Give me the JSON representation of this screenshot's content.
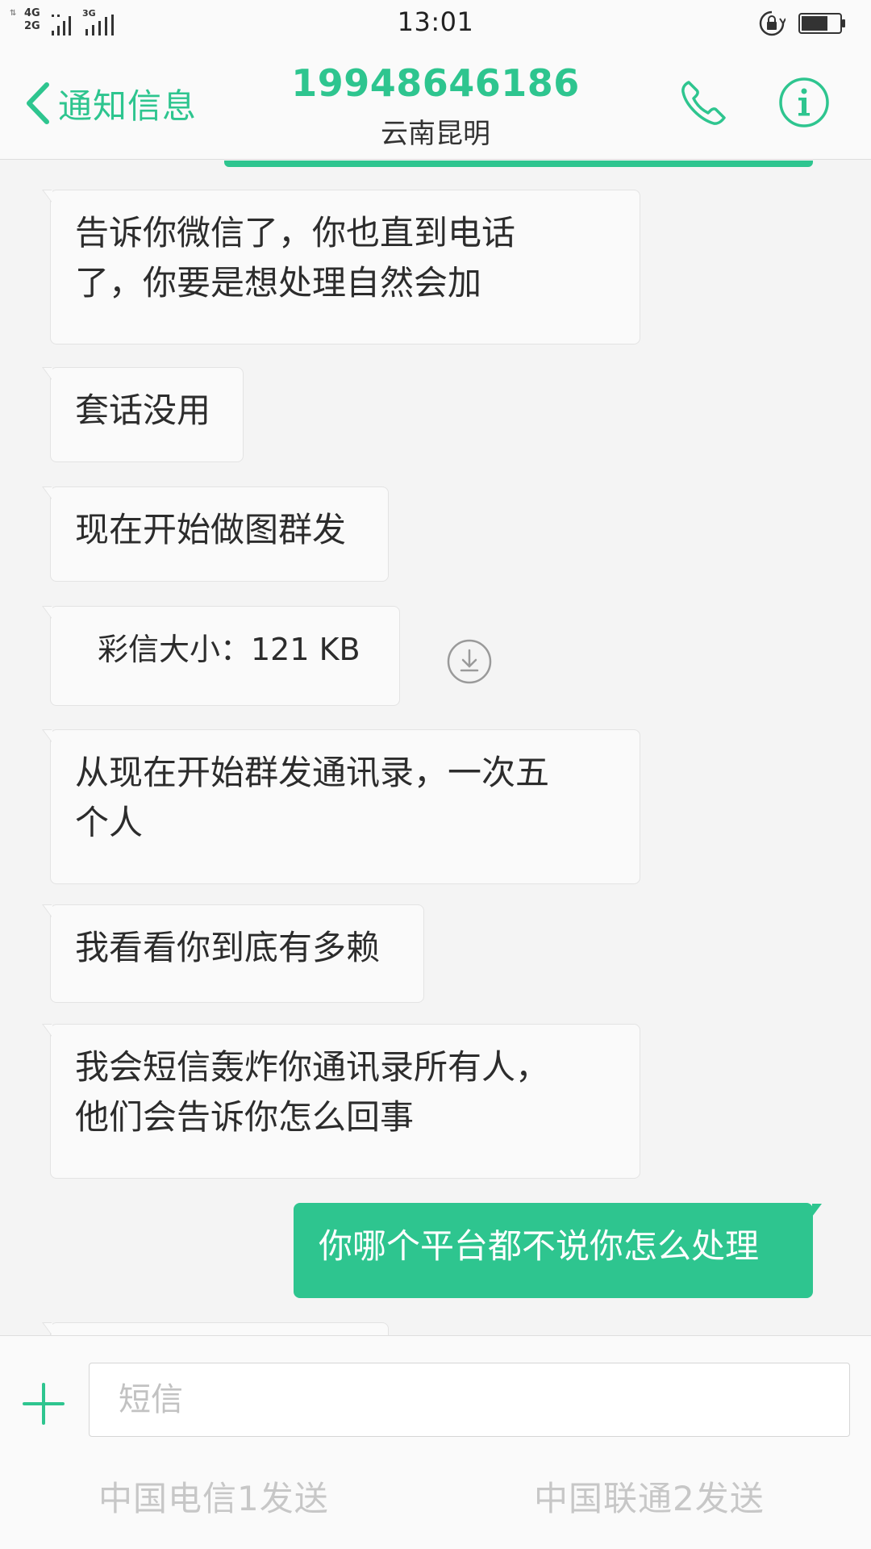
{
  "status_bar": {
    "time": "13:01",
    "network_top": "4G",
    "network_bottom": "2G",
    "network_secondary": "3G"
  },
  "header": {
    "back_label": "通知信息",
    "contact_number": "19948646186",
    "contact_location": "云南昆明"
  },
  "messages": [
    {
      "direction": "in",
      "lines": [
        "告诉你微信了，你也直到电话",
        "了，你要是想处理自然会加"
      ]
    },
    {
      "direction": "in",
      "lines": [
        "套话没用"
      ]
    },
    {
      "direction": "in",
      "lines": [
        "现在开始做图群发"
      ]
    },
    {
      "direction": "in",
      "lines": [
        "彩信大小：121 KB"
      ],
      "type": "mms"
    },
    {
      "direction": "in",
      "lines": [
        "从现在开始群发通讯录，一次五",
        "个人"
      ]
    },
    {
      "direction": "in",
      "lines": [
        "我看看你到底有多赖"
      ]
    },
    {
      "direction": "in",
      "lines": [
        "我会短信轰炸你通讯录所有人，",
        "他们会告诉你怎么回事"
      ]
    },
    {
      "direction": "out",
      "lines": [
        "你哪个平台都不说你怎么处理"
      ]
    }
  ],
  "compose": {
    "placeholder": "短信",
    "send_sim1": "中国电信1发送",
    "send_sim2": "中国联通2发送"
  },
  "colors": {
    "accent": "#2ec58f",
    "bubble_in": "#fafafa",
    "background": "#f4f4f4"
  },
  "icons": [
    "chevron-left-icon",
    "phone-icon",
    "info-icon",
    "download-icon",
    "plus-icon",
    "signal-icon",
    "lock-rotation-icon",
    "battery-icon"
  ]
}
